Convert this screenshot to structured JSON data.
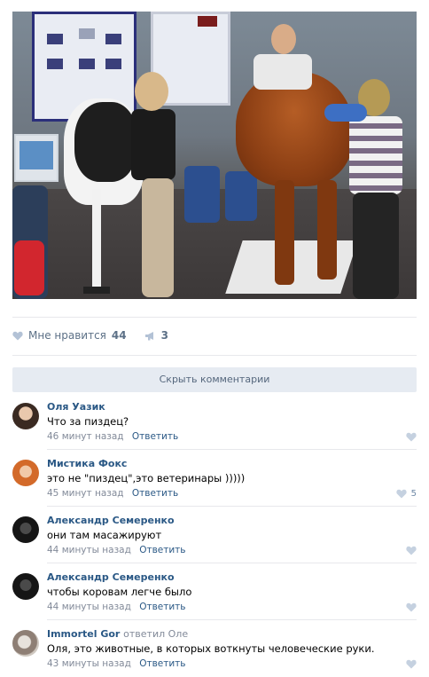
{
  "post": {
    "likes_label": "Мне нравится",
    "likes_count": "44",
    "reposts_count": "3"
  },
  "hide_comments_label": "Скрыть комментарии",
  "comments": [
    {
      "author": "Оля Уазик",
      "reply_to": "",
      "text": "Что за пиздец?",
      "time": "46 минут назад",
      "reply_label": "Ответить",
      "likes": ""
    },
    {
      "author": "Мистика Фокс",
      "reply_to": "",
      "text": "это не \"пиздец\",это ветеринары )))))",
      "time": "45 минут назад",
      "reply_label": "Ответить",
      "likes": "5"
    },
    {
      "author": "Александр Семеренко",
      "reply_to": "",
      "text": "они там масажируют",
      "time": "44 минуты назад",
      "reply_label": "Ответить",
      "likes": ""
    },
    {
      "author": "Александр Семеренко",
      "reply_to": "",
      "text": "чтобы коровам легче было",
      "time": "44 минуты назад",
      "reply_label": "Ответить",
      "likes": ""
    },
    {
      "author": "Immortel Gor",
      "reply_to": "ответил Оле",
      "text": "Оля, это животные, в которых воткнуты человеческие руки.",
      "time": "43 минуты назад",
      "reply_label": "Ответить",
      "likes": ""
    }
  ],
  "colors": {
    "link": "#2a5885",
    "meta": "#828a99",
    "button_bg": "#e6ebf2"
  }
}
